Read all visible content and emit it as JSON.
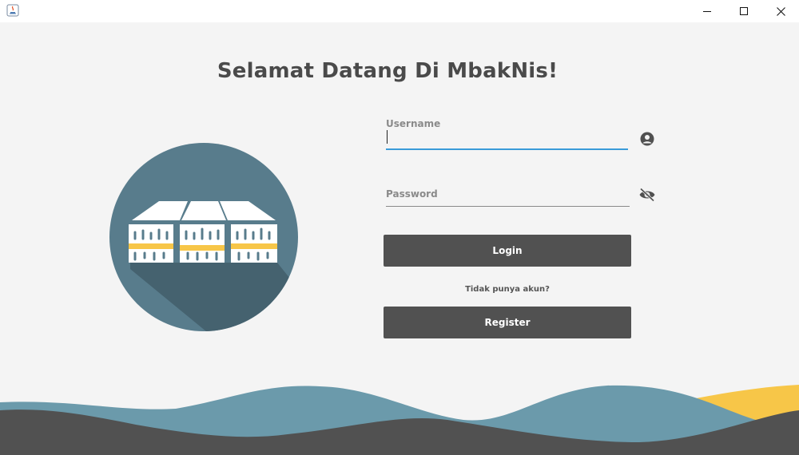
{
  "window": {
    "controls": {
      "minimize_icon": "minimize-icon",
      "maximize_icon": "maximize-icon",
      "close_icon": "close-icon"
    }
  },
  "heading": "Selamat Datang Di MbakNis!",
  "form": {
    "username": {
      "label": "Username",
      "value": "",
      "icon": "user-circle-icon"
    },
    "password": {
      "label": "Password",
      "value": "",
      "icon": "eye-slash-icon"
    },
    "login_label": "Login",
    "no_account_text": "Tidak punya akun?",
    "register_label": "Register"
  },
  "colors": {
    "background": "#f4f4f4",
    "button": "#515151",
    "focus_underline": "#3a9bd9",
    "logo_circle": "#587c8c",
    "wave_teal": "#6b9aab",
    "wave_yellow": "#f7c648",
    "wave_dark": "#515151"
  }
}
